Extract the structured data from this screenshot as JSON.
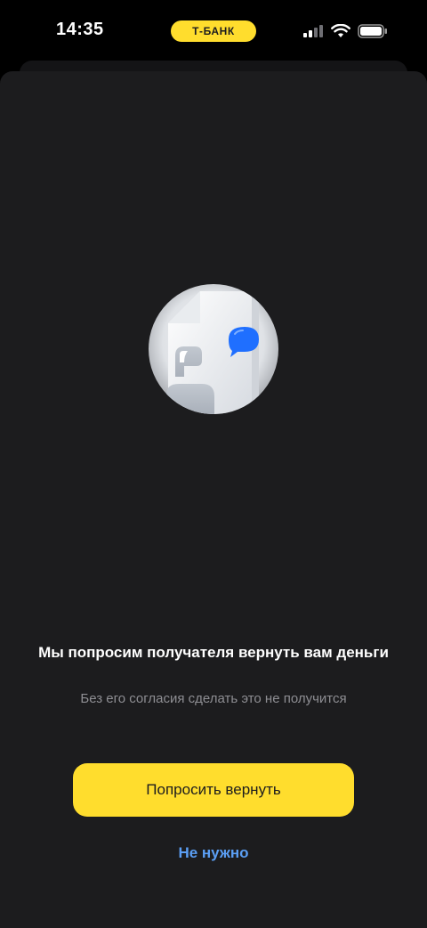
{
  "status_bar": {
    "time": "14:35",
    "bank_name": "Т‑БАНК",
    "icons": [
      "cellular-signal-icon",
      "wifi-icon",
      "battery-icon"
    ]
  },
  "content": {
    "title": "Мы попросим получателя вернуть вам деньги",
    "subtitle": "Без его согласия сделать это не получится"
  },
  "actions": {
    "primary_label": "Попросить вернуть",
    "secondary_label": "Не нужно"
  },
  "colors": {
    "accent": "#ffdd2d",
    "link": "#5b9ff5",
    "sheet_background": "#1c1c1e",
    "chat_bubble": "#1f6fff"
  }
}
